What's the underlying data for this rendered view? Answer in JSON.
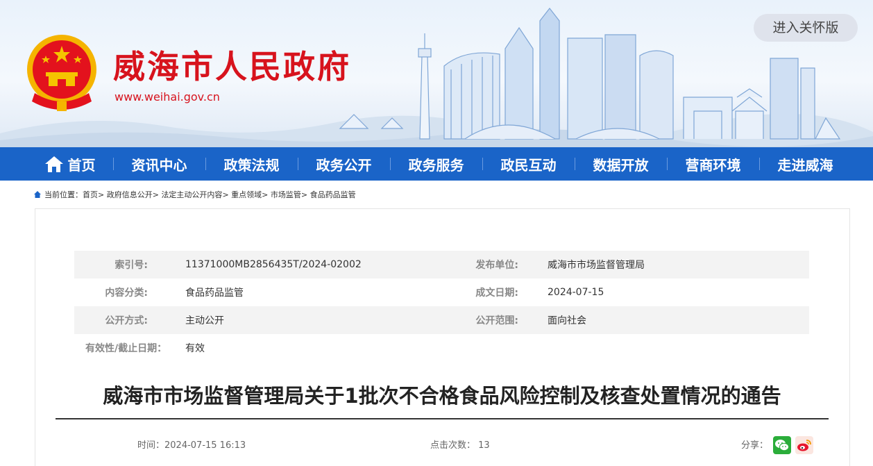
{
  "header": {
    "site_title": "威海市人民政府",
    "site_url": "www.weihai.gov.cn",
    "care_button": "进入关怀版",
    "emblem_icon": "national-emblem-icon"
  },
  "nav": {
    "items": [
      {
        "label": "首页",
        "icon": "home-icon"
      },
      {
        "label": "资讯中心"
      },
      {
        "label": "政策法规"
      },
      {
        "label": "政务公开"
      },
      {
        "label": "政务服务"
      },
      {
        "label": "政民互动"
      },
      {
        "label": "数据开放"
      },
      {
        "label": "营商环境"
      },
      {
        "label": "走进威海"
      }
    ]
  },
  "breadcrumb": {
    "prefix": "当前位置：",
    "items": [
      "首页",
      "政府信息公开",
      "法定主动公开内容",
      "重点领域",
      "市场监管",
      "食品药品监管"
    ],
    "separator": ">"
  },
  "meta": {
    "index_label": "索引号:",
    "index_value": "11371000MB2856435T/2024-02002",
    "publisher_label": "发布单位:",
    "publisher_value": "威海市市场监督管理局",
    "category_label": "内容分类:",
    "category_value": "食品药品监管",
    "date_label": "成文日期:",
    "date_value": "2024-07-15",
    "method_label": "公开方式:",
    "method_value": "主动公开",
    "scope_label": "公开范围:",
    "scope_value": "面向社会",
    "validity_label": "有效性/截止日期：",
    "validity_value": "有效"
  },
  "article": {
    "title": "威海市市场监督管理局关于1批次不合格食品风险控制及核查处置情况的通告",
    "time_text": "时间：2024-07-15 16:13",
    "clicks_text": "点击次数： 13",
    "share_label": "分享：",
    "share_icons": [
      "wechat-icon",
      "weibo-icon"
    ]
  },
  "colors": {
    "brand_red": "#d7131d",
    "nav_blue": "#1a64c8"
  }
}
